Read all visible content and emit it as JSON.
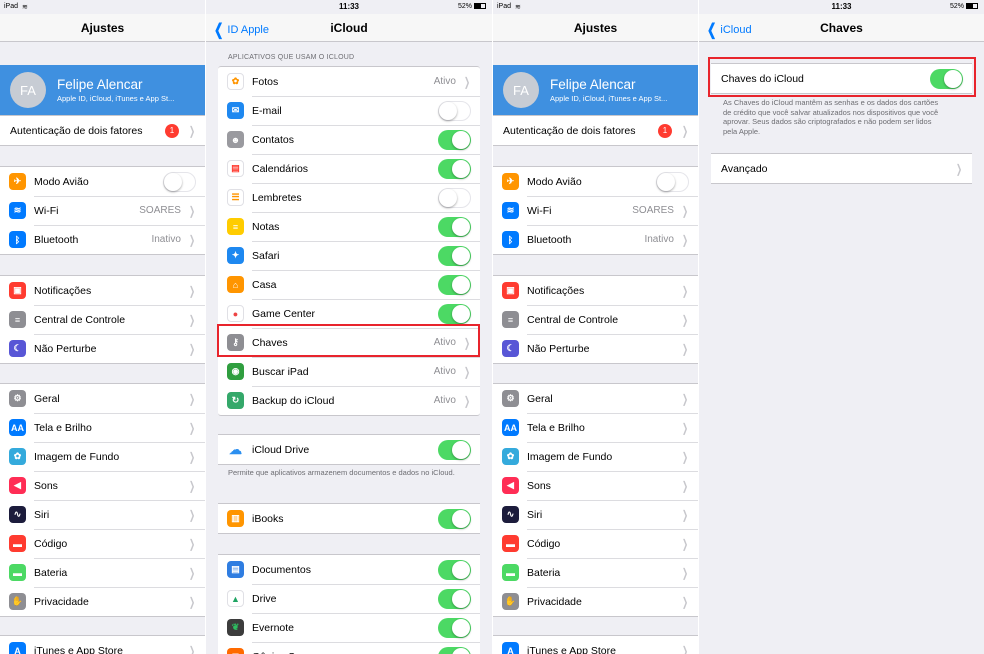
{
  "status": {
    "device": "iPad",
    "time": "11:33",
    "battery": "52%"
  },
  "settings": {
    "title": "Ajustes",
    "profile": {
      "initials": "FA",
      "name": "Felipe Alencar",
      "subtitle": "Apple ID, iCloud, iTunes e App St..."
    },
    "two_factor": {
      "label": "Autenticação de dois fatores",
      "badge": "1"
    },
    "group1": [
      {
        "label": "Modo Avião",
        "icon": "airplane-icon",
        "color": "#ff9500",
        "glyph": "✈",
        "toggle": "off"
      },
      {
        "label": "Wi-Fi",
        "icon": "wifi-icon",
        "color": "#007aff",
        "glyph": "≋",
        "value": "SOARES"
      },
      {
        "label": "Bluetooth",
        "icon": "bluetooth-icon",
        "color": "#007aff",
        "glyph": "ᛒ",
        "value": "Inativo"
      }
    ],
    "group2": [
      {
        "label": "Notificações",
        "icon": "notifications-icon",
        "color": "#ff3b30",
        "glyph": "▣"
      },
      {
        "label": "Central de Controle",
        "icon": "control-center-icon",
        "color": "#8e8e93",
        "glyph": "≡"
      },
      {
        "label": "Não Perturbe",
        "icon": "moon-icon",
        "color": "#5856d6",
        "glyph": "☾"
      }
    ],
    "group3": [
      {
        "label": "Geral",
        "icon": "gear-icon",
        "color": "#8e8e93",
        "glyph": "⚙"
      },
      {
        "label": "Tela e Brilho",
        "icon": "display-icon",
        "color": "#007aff",
        "glyph": "AA"
      },
      {
        "label": "Imagem de Fundo",
        "icon": "wallpaper-icon",
        "color": "#34aadc",
        "glyph": "✿"
      },
      {
        "label": "Sons",
        "icon": "sound-icon",
        "color": "#ff2d55",
        "glyph": "◀"
      },
      {
        "label": "Siri",
        "icon": "siri-icon",
        "color": "#1c1c3c",
        "glyph": "∿"
      },
      {
        "label": "Código",
        "icon": "lock-icon",
        "color": "#ff3b30",
        "glyph": "▬"
      },
      {
        "label": "Bateria",
        "icon": "battery-icon",
        "color": "#4cd964",
        "glyph": "▬"
      },
      {
        "label": "Privacidade",
        "icon": "hand-icon",
        "color": "#8e8e93",
        "glyph": "✋"
      }
    ],
    "group4": [
      {
        "label": "iTunes e App Store",
        "icon": "app-store-icon",
        "color": "#007aff",
        "glyph": "A"
      }
    ]
  },
  "icloud": {
    "back": "ID Apple",
    "title": "iCloud",
    "header": "APLICATIVOS QUE USAM O ICLOUD",
    "apps": [
      {
        "label": "Fotos",
        "icon": "photos-icon",
        "color": "#ffffff",
        "glyph": "✿",
        "gcolor": "#ff9500",
        "value": "Ativo"
      },
      {
        "label": "E-mail",
        "icon": "mail-icon",
        "color": "#1e88f0",
        "glyph": "✉",
        "toggle": "off"
      },
      {
        "label": "Contatos",
        "icon": "contacts-icon",
        "color": "#9a9a9f",
        "glyph": "☻",
        "toggle": "on"
      },
      {
        "label": "Calendários",
        "icon": "calendar-icon",
        "color": "#ffffff",
        "glyph": "▤",
        "gcolor": "#ff3b30",
        "toggle": "on"
      },
      {
        "label": "Lembretes",
        "icon": "reminders-icon",
        "color": "#ffffff",
        "glyph": "☰",
        "gcolor": "#ff9500",
        "toggle": "off"
      },
      {
        "label": "Notas",
        "icon": "notes-icon",
        "color": "#ffcc00",
        "glyph": "≡",
        "toggle": "on"
      },
      {
        "label": "Safari",
        "icon": "safari-icon",
        "color": "#1e88f0",
        "glyph": "✦",
        "toggle": "on"
      },
      {
        "label": "Casa",
        "icon": "home-icon",
        "color": "#ff9500",
        "glyph": "⌂",
        "toggle": "on"
      },
      {
        "label": "Game Center",
        "icon": "game-center-icon",
        "color": "#ffffff",
        "glyph": "●",
        "gcolor": "#e44",
        "toggle": "on"
      },
      {
        "label": "Chaves",
        "icon": "key-icon",
        "color": "#8e8e93",
        "glyph": "⚷",
        "value": "Ativo"
      },
      {
        "label": "Buscar iPad",
        "icon": "find-ipad-icon",
        "color": "#2f9e3f",
        "glyph": "◉",
        "value": "Ativo"
      },
      {
        "label": "Backup do iCloud",
        "icon": "backup-icon",
        "color": "#34a86a",
        "glyph": "↻",
        "value": "Ativo"
      }
    ],
    "drive": {
      "label": "iCloud Drive",
      "icon": "cloud-icon",
      "toggle": "on",
      "footer": "Permite que aplicativos armazenem documentos e dados no iCloud."
    },
    "ibooks": {
      "label": "iBooks",
      "icon": "ibooks-icon",
      "toggle": "on"
    },
    "docs": [
      {
        "label": "Documentos",
        "icon": "documents-icon",
        "color": "#2f7de1",
        "glyph": "▤",
        "toggle": "on"
      },
      {
        "label": "Drive",
        "icon": "google-drive-icon",
        "color": "#ffffff",
        "glyph": "▲",
        "gcolor": "#1fa463",
        "toggle": "on"
      },
      {
        "label": "Evernote",
        "icon": "evernote-icon",
        "color": "#3c3c3c",
        "glyph": "❦",
        "gcolor": "#2dbe60",
        "toggle": "on"
      },
      {
        "label": "Gênius Scan",
        "icon": "genius-scan-icon",
        "color": "#ff6a00",
        "glyph": "◼",
        "toggle": "on"
      }
    ]
  },
  "keychain": {
    "back": "iCloud",
    "title": "Chaves",
    "toggle_label": "Chaves do iCloud",
    "toggle": "on",
    "footer": "As Chaves do iCloud mantêm as senhas e os dados dos cartões de crédito que você salvar atualizados nos dispositivos que você aprovar. Seus dados são criptografados e não podem ser lidos pela Apple.",
    "advanced": "Avançado"
  }
}
